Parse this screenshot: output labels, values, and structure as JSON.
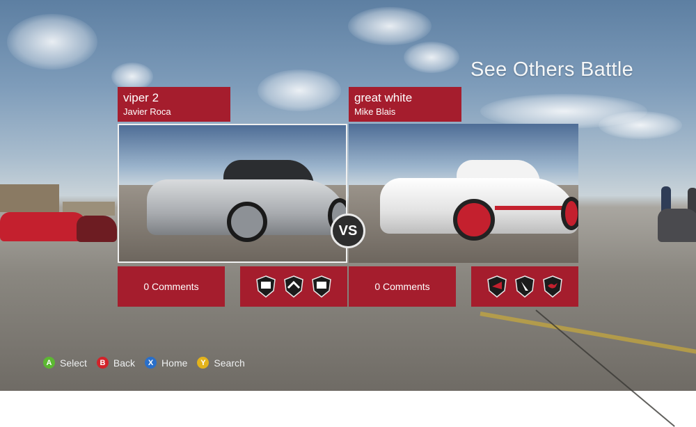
{
  "page_title": "See Others Battle",
  "battle": {
    "left": {
      "name": "viper 2",
      "author": "Javier  Roca",
      "comments_label": "0 Comments",
      "badges": [
        "badge-icon",
        "chevron-badge-icon",
        "badge-icon"
      ]
    },
    "right": {
      "name": "great white",
      "author": "Mike  Blais",
      "comments_label": "0 Comments",
      "badges": [
        "badge-icon",
        "badge-icon",
        "bird-badge-icon"
      ]
    },
    "vs_label": "VS"
  },
  "footer": {
    "buttons": [
      {
        "key": "A",
        "label": "Select",
        "color": "#5cb832"
      },
      {
        "key": "B",
        "label": "Back",
        "color": "#d2232a"
      },
      {
        "key": "X",
        "label": "Home",
        "color": "#2a6fc9"
      },
      {
        "key": "Y",
        "label": "Search",
        "color": "#e3b31b"
      }
    ]
  },
  "colors": {
    "accent": "#a51d2d",
    "title": "#f5f7f8"
  }
}
